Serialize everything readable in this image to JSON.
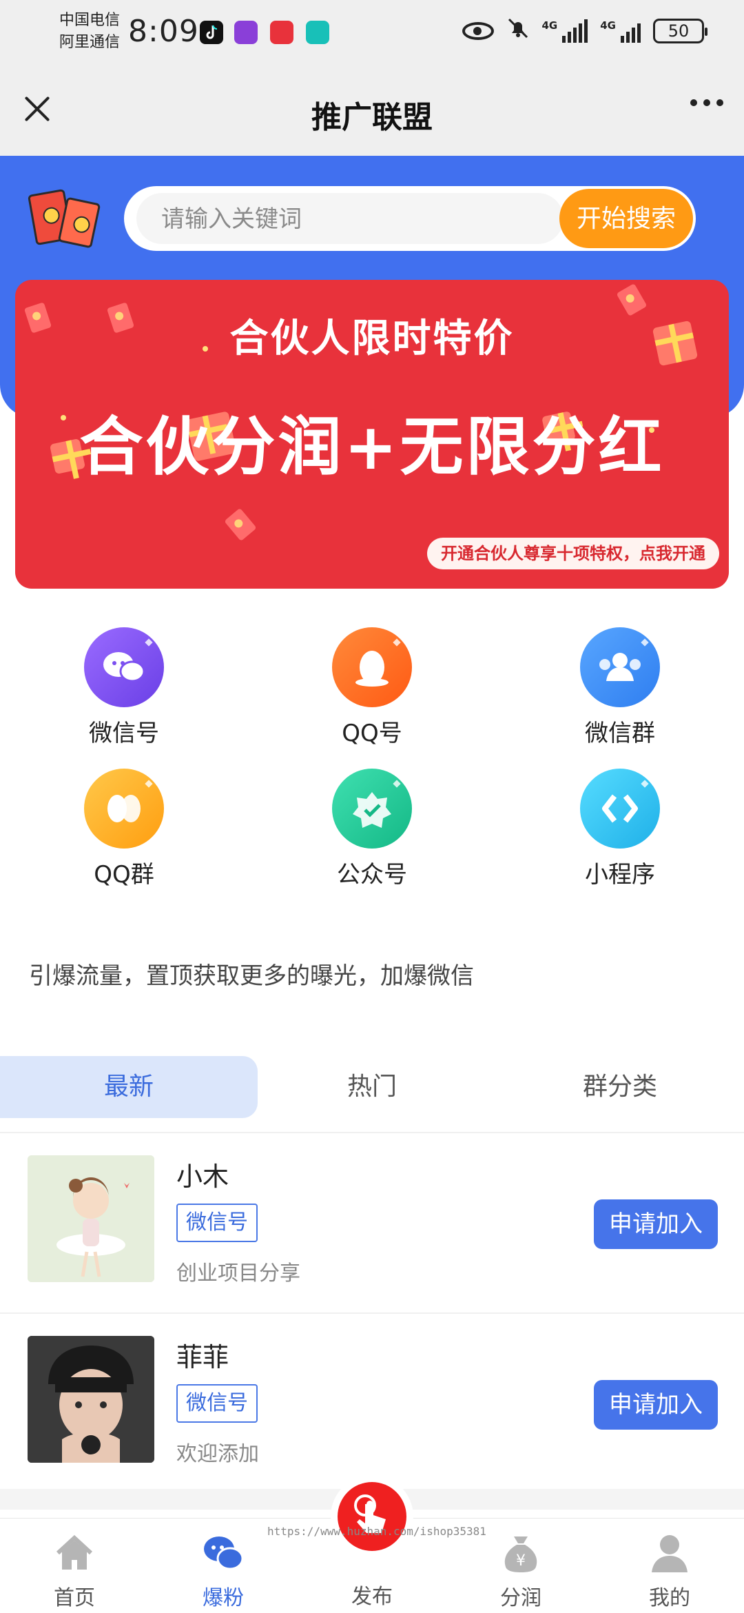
{
  "status_bar": {
    "carrier_1": "中国电信",
    "carrier_2": "阿里通信",
    "time": "8:09",
    "network_1": "4G",
    "network_2": "4G",
    "battery": "50"
  },
  "header": {
    "title": "推广联盟"
  },
  "search": {
    "placeholder": "请输入关键词",
    "button_label": "开始搜索"
  },
  "banner": {
    "subtitle": "合伙人限时特价",
    "headline": "合伙分润+无限分红",
    "cta": "开通合伙人尊享十项特权，点我开通"
  },
  "categories": [
    {
      "label": "微信号",
      "icon": "wechat-icon",
      "color": "#7b4ff0"
    },
    {
      "label": "QQ号",
      "icon": "qq-icon",
      "color": "#ff6a1f"
    },
    {
      "label": "微信群",
      "icon": "group-icon",
      "color": "#3b8df2"
    },
    {
      "label": "QQ群",
      "icon": "qq-group-icon",
      "color": "#ffb21e"
    },
    {
      "label": "公众号",
      "icon": "official-account-icon",
      "color": "#1fc79a"
    },
    {
      "label": "小程序",
      "icon": "mini-program-icon",
      "color": "#2ec5f0"
    }
  ],
  "promo_text": "引爆流量，置顶获取更多的曝光，加爆微信",
  "tabs": [
    {
      "label": "最新",
      "active": true
    },
    {
      "label": "热门",
      "active": false
    },
    {
      "label": "群分类",
      "active": false
    }
  ],
  "listings": [
    {
      "name": "小木",
      "tag": "微信号",
      "desc": "创业项目分享",
      "button": "申请加入"
    },
    {
      "name": "菲菲",
      "tag": "微信号",
      "desc": "欢迎添加",
      "button": "申请加入"
    }
  ],
  "bottom_nav": [
    {
      "label": "首页",
      "icon": "home-icon",
      "active": false
    },
    {
      "label": "爆粉",
      "icon": "chat-bubbles-icon",
      "active": true
    },
    {
      "label": "发布",
      "icon": "tap-hand-icon",
      "active": false
    },
    {
      "label": "分润",
      "icon": "money-bag-icon",
      "active": false
    },
    {
      "label": "我的",
      "icon": "user-icon",
      "active": false
    }
  ],
  "footer_watermark": "https://www.huzhan.com/ishop35381",
  "colors": {
    "brand_blue": "#4170ef",
    "banner_red": "#e8323b",
    "search_orange": "#ff9a14",
    "publish_red": "#ef2020"
  }
}
